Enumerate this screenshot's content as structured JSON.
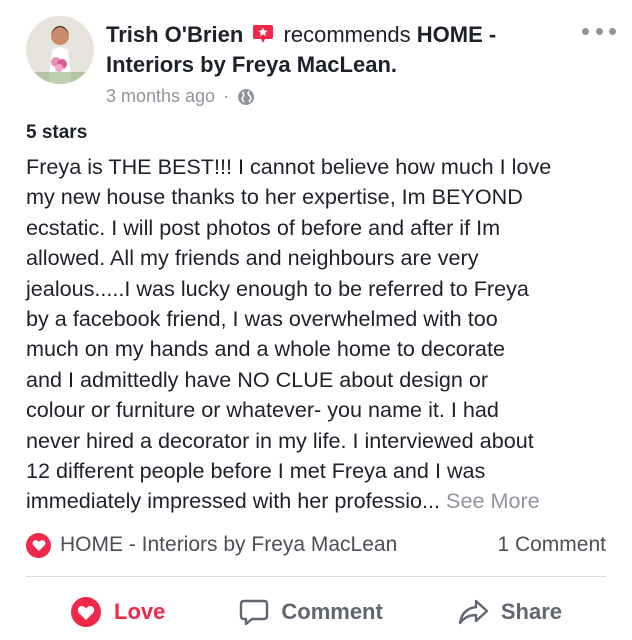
{
  "post": {
    "author": "Trish O'Brien",
    "verb": "recommends",
    "page_name_line1": "HOME -",
    "page_name_line2": "Interiors by Freya MacLean.",
    "timestamp": "3 months ago",
    "separator": "·",
    "rating": "5 stars",
    "review_lines": [
      "Freya is THE BEST!!! I cannot believe how much I love",
      "my new house thanks to her expertise, Im BEYOND",
      "ecstatic. I will post photos of before and after if Im",
      "allowed. All my friends and neighbours are very",
      "jealous.....I was lucky enough to be referred to Freya",
      "by a facebook friend, I was overwhelmed with too",
      "much on my hands and a whole home to decorate",
      "and I admittedly have NO CLUE about design or",
      "colour or furniture or whatever- you name it. I had",
      "never hired a decorator in my life. I interviewed about",
      "12 different people before I met Freya and I was",
      "immediately impressed with her professio..."
    ],
    "see_more": "See More"
  },
  "footer": {
    "page_label": "HOME - Interiors by Freya MacLean",
    "comment_count": "1 Comment"
  },
  "actions": {
    "love": "Love",
    "comment": "Comment",
    "share": "Share"
  },
  "colors": {
    "love_red": "#f0284a",
    "meta_gray": "#90949c",
    "text_dark": "#1d2129"
  },
  "icons": [
    "recommend-badge-icon",
    "globe-icon",
    "more-options-icon",
    "heart-icon",
    "comment-icon",
    "share-icon"
  ]
}
